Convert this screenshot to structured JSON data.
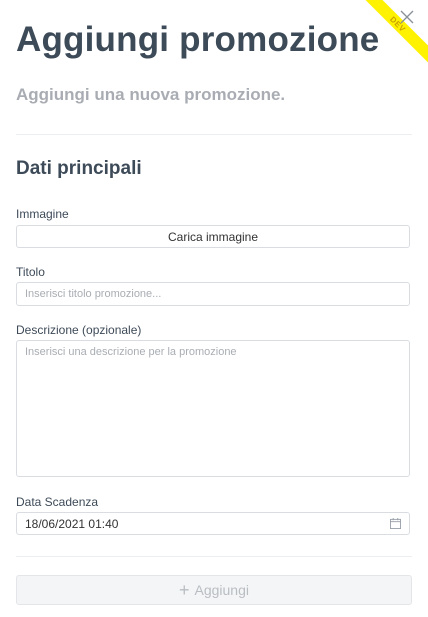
{
  "header": {
    "title": "Aggiungi promozione",
    "subtitle": "Aggiungi una nuova promozione.",
    "ribbon_text": "DEV"
  },
  "section": {
    "title": "Dati principali"
  },
  "fields": {
    "image_label": "Immagine",
    "image_button": "Carica immagine",
    "title_label": "Titolo",
    "title_placeholder": "Inserisci titolo promozione...",
    "description_label": "Descrizione (opzionale)",
    "description_placeholder": "Inserisci una descrizione per la promozione",
    "date_label": "Data Scadenza",
    "date_value": "18/06/2021 01:40"
  },
  "actions": {
    "add_label": "Aggiungi"
  },
  "icons": {
    "close": "close-icon",
    "calendar": "calendar-icon",
    "plus": "plus-icon"
  },
  "colors": {
    "title": "#3d4a58",
    "muted": "#a9adb3",
    "ribbon": "#fff200"
  }
}
